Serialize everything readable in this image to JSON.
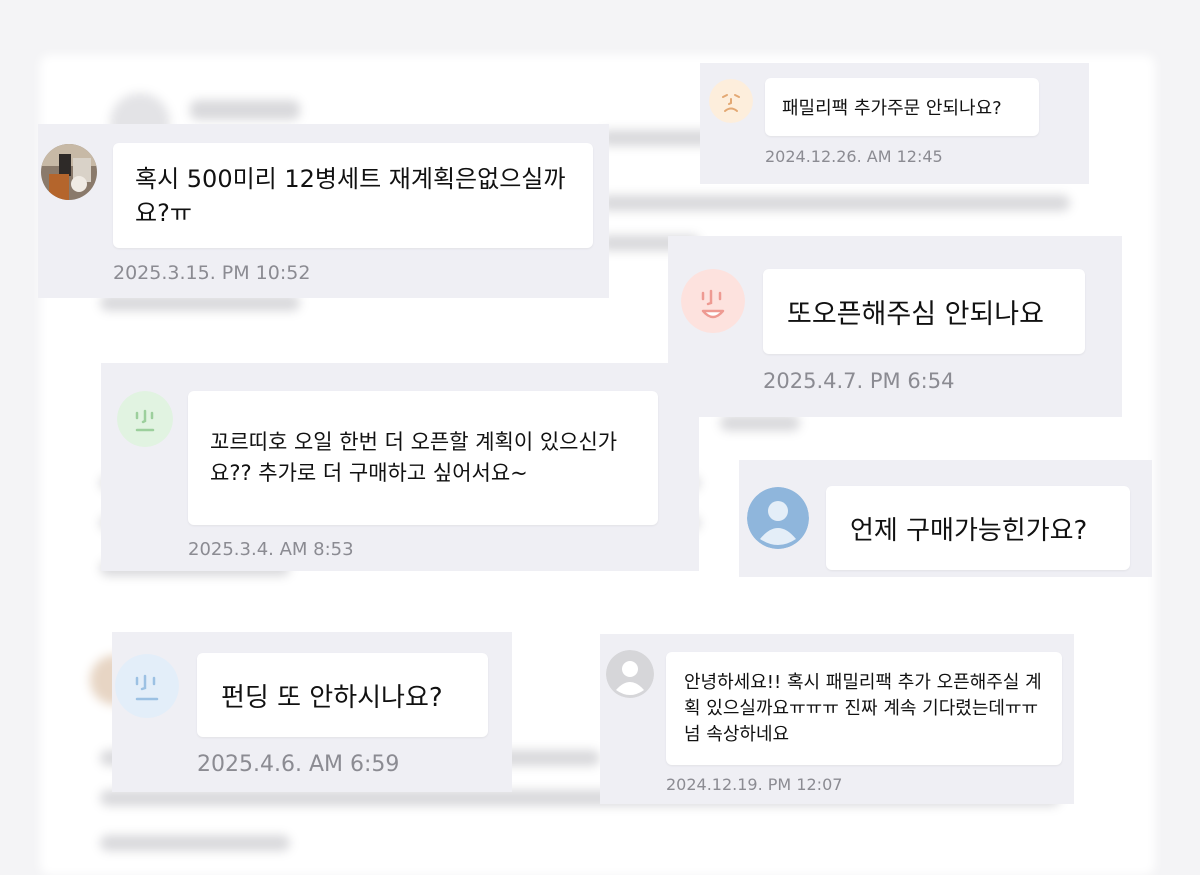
{
  "messages": [
    {
      "text": "혹시 500미리 12병세트 재계획은없으실까요?ㅠ",
      "time": "2025.3.15. PM 10:52",
      "avatar": "photo-avatar"
    },
    {
      "text": "패밀리팩 추가주문 안되나요?",
      "time": "2024.12.26. AM 12:45",
      "avatar": "orange-face-avatar"
    },
    {
      "text": "또오픈해주심 안되나요",
      "time": "2025.4.7. PM 6:54",
      "avatar": "pink-face-avatar"
    },
    {
      "text": "꼬르띠호 오일 한번 더 오픈할 계획이 있으신가요?? 추가로 더 구매하고 싶어서요~",
      "time": "2025.3.4. AM 8:53",
      "avatar": "green-face-avatar"
    },
    {
      "text": "언제 구매가능힌가요?",
      "time": "",
      "avatar": "default-user-avatar"
    },
    {
      "text": "펀딩 또 안하시나요?",
      "time": "2025.4.6. AM 6:59",
      "avatar": "blue-face-avatar"
    },
    {
      "text": "안녕하세요!! 혹시 패밀리팩 추가 오픈해주실 계획 있으실까요ㅠㅠㅠ 진짜 계속 기다렸는데ㅠㅠ 넘 속상하네요",
      "time": "2024.12.19. PM 12:07",
      "avatar": "gray-user-avatar"
    }
  ],
  "colors": {
    "card_bg": "#efeff4",
    "bubble_bg": "#ffffff",
    "text": "#111111",
    "time": "#8b8b92"
  }
}
